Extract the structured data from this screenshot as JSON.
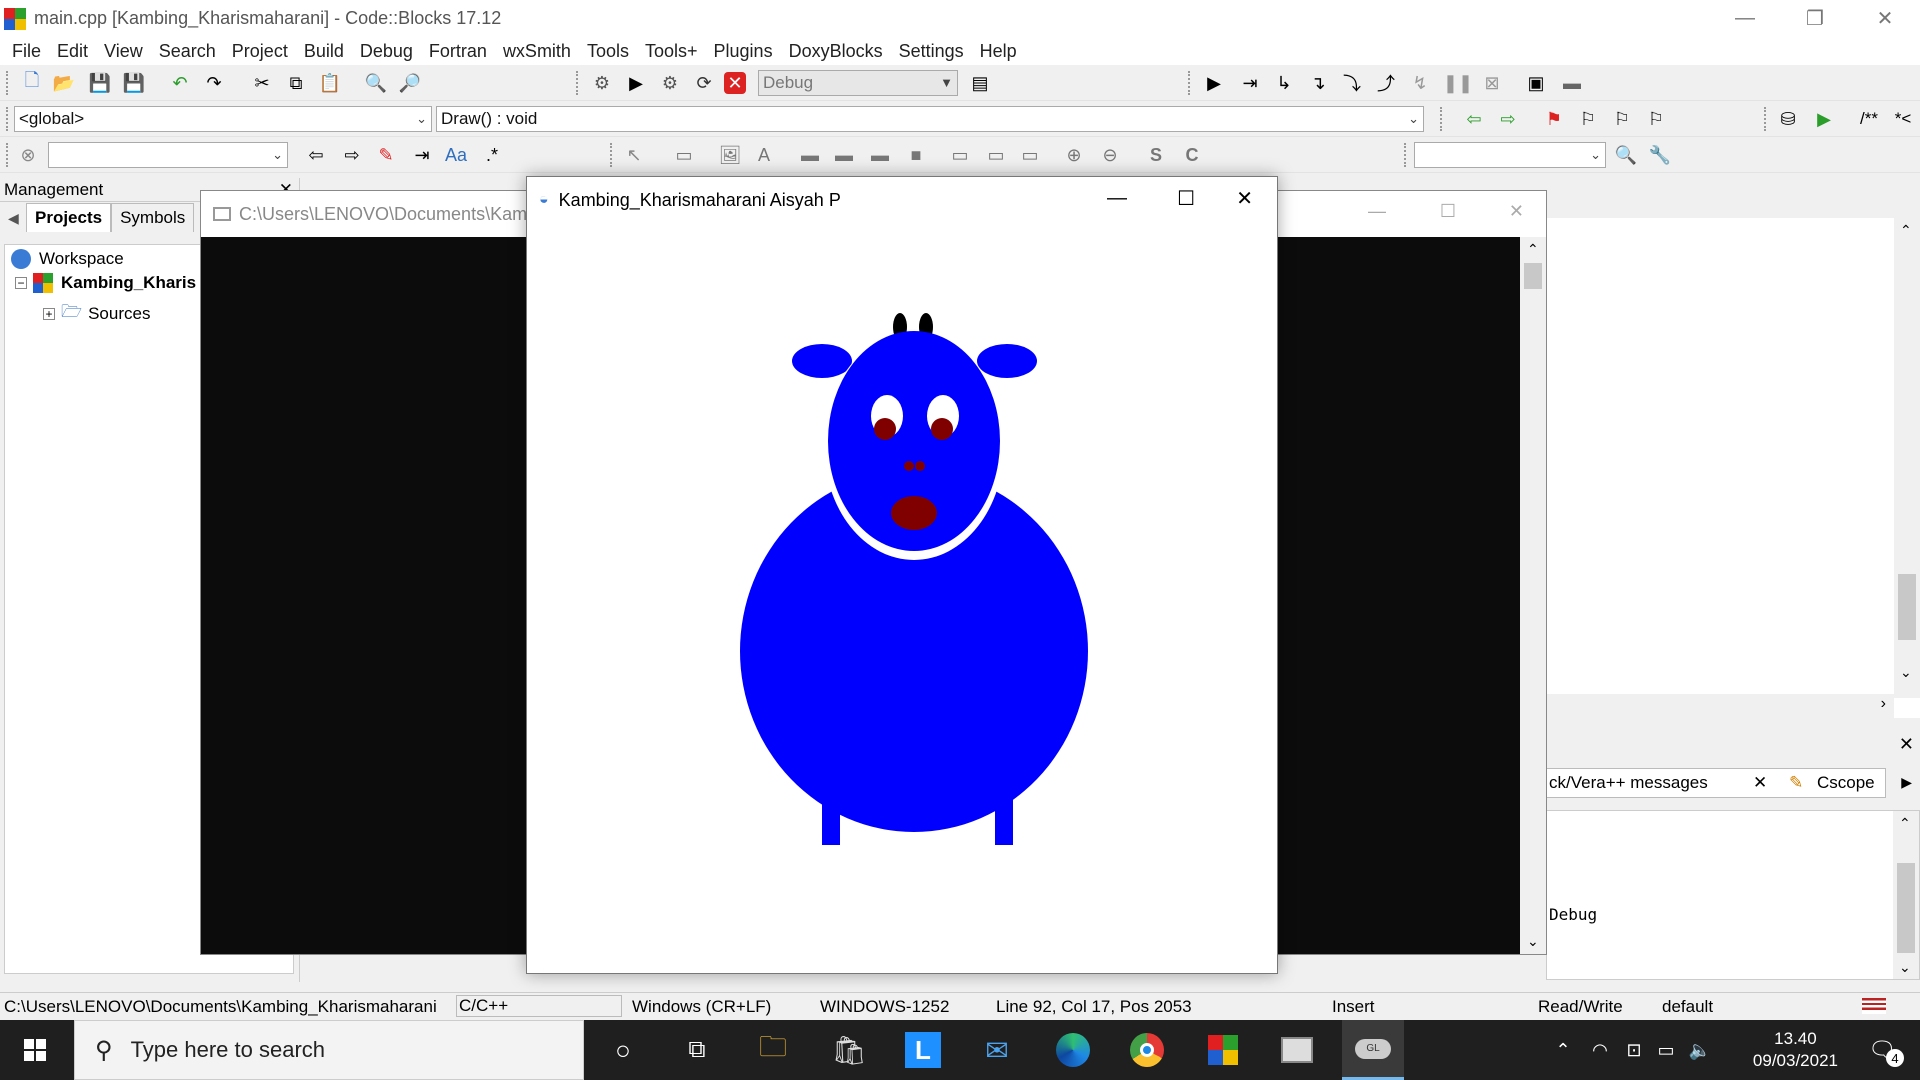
{
  "window": {
    "title": "main.cpp [Kambing_Kharismaharani] - Code::Blocks 17.12",
    "minimize": "—",
    "restore": "❐",
    "close": "✕"
  },
  "menu": [
    "File",
    "Edit",
    "View",
    "Search",
    "Project",
    "Build",
    "Debug",
    "Fortran",
    "wxSmith",
    "Tools",
    "Tools+",
    "Plugins",
    "DoxyBlocks",
    "Settings",
    "Help"
  ],
  "toolbar": {
    "build_target": "Debug",
    "scope": "<global>",
    "function": "Draw() : void",
    "doxy_label1": "/**",
    "doxy_label2": "*<"
  },
  "management": {
    "header": "Management",
    "tabs": [
      "Projects",
      "Symbols"
    ],
    "workspace": "Workspace",
    "project": "Kambing_Kharis",
    "sources": "Sources"
  },
  "console_window": {
    "title": "C:\\Users\\LENOVO\\Documents\\Kamb"
  },
  "gl_window": {
    "title": "Kambing_Kharismaharani Aisyah P",
    "body_color": "#0000ff",
    "eye_pupil_color": "#800000",
    "horn_color": "#000000"
  },
  "logs": {
    "tab_vera": "ck/Vera++ messages",
    "tab_cscope": "Cscope",
    "debug_text": "Debug"
  },
  "status": {
    "path": "C:\\Users\\LENOVO\\Documents\\Kambing_Kharismaharani",
    "lang": "C/C++",
    "eol": "Windows (CR+LF)",
    "encoding": "WINDOWS-1252",
    "position": "Line 92, Col 17, Pos 2053",
    "mode": "Insert",
    "access": "Read/Write",
    "profile": "default"
  },
  "taskbar": {
    "search_placeholder": "Type here to search",
    "time": "13.40",
    "date": "09/03/2021",
    "notif_count": "4"
  }
}
